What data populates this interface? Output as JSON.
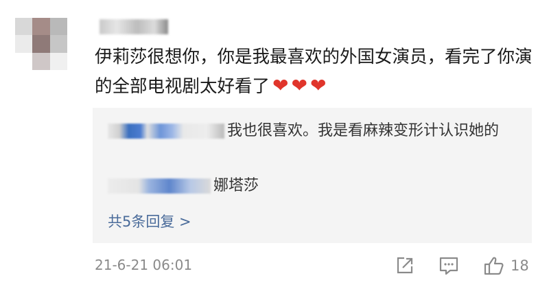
{
  "comment": {
    "text": "伊莉莎很想你，你是我最喜欢的外国女演员，看完了你演的全部电视剧太好看了",
    "reactions": "❤️ ❤️ ❤️",
    "heart": "❤"
  },
  "replies": {
    "first_text": "我也很喜欢。我是看麻辣变形计认识她的",
    "second_text": "娜塔莎",
    "more_link": "共5条回复 >"
  },
  "footer": {
    "timestamp": "21-6-21 06:01",
    "like_count": "18"
  },
  "icons": {
    "share": "share-icon",
    "comment": "comment-icon",
    "like": "like-icon"
  },
  "colors": {
    "heart": "#e0352b",
    "link": "#4a6b9a",
    "meta": "#8a8a8a"
  }
}
